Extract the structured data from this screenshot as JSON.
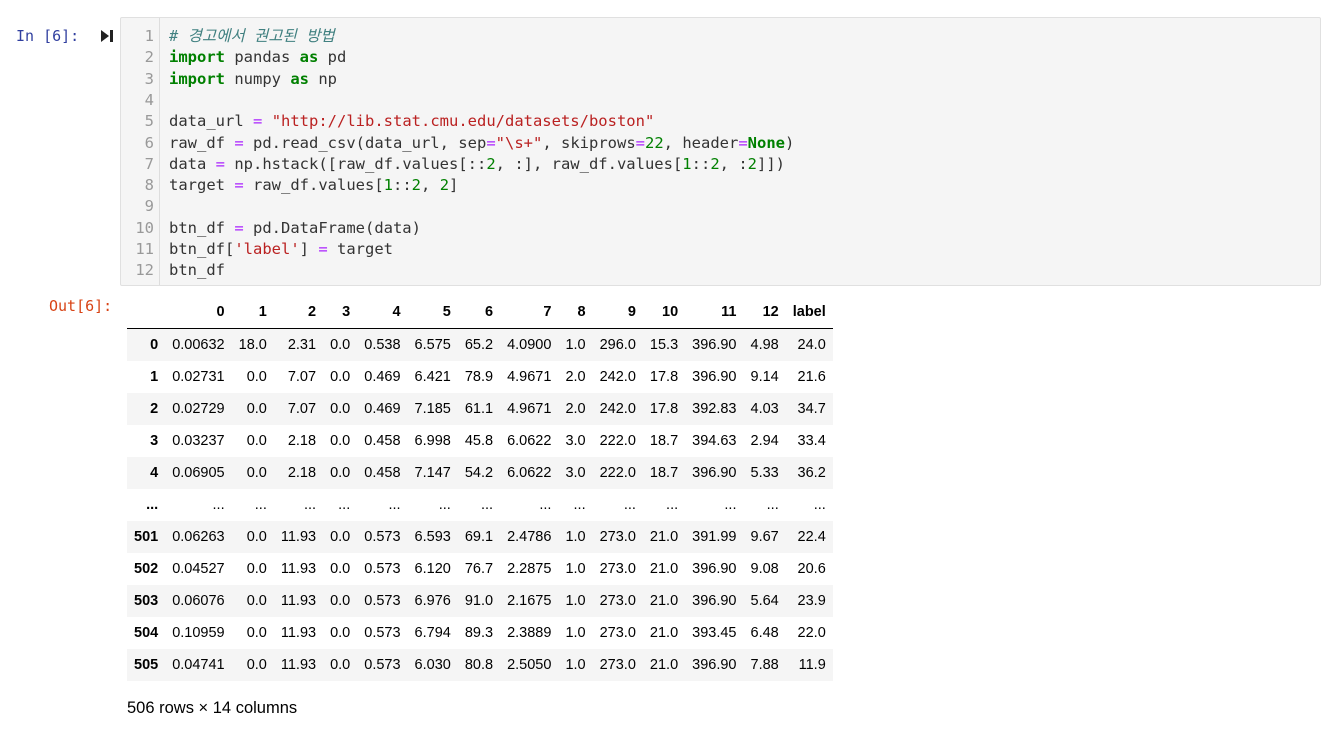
{
  "input_prompt": "In [6]:",
  "output_prompt": "Out[6]:",
  "code_lines": [
    {
      "n": "1",
      "tokens": [
        {
          "t": "# 경고에서 권고된 방법",
          "c": "c"
        }
      ]
    },
    {
      "n": "2",
      "tokens": [
        {
          "t": "import",
          "c": "kc"
        },
        {
          "t": " pandas ",
          "c": ""
        },
        {
          "t": "as",
          "c": "kc"
        },
        {
          "t": " pd",
          "c": ""
        }
      ]
    },
    {
      "n": "3",
      "tokens": [
        {
          "t": "import",
          "c": "kc"
        },
        {
          "t": " numpy ",
          "c": ""
        },
        {
          "t": "as",
          "c": "kc"
        },
        {
          "t": " np",
          "c": ""
        }
      ]
    },
    {
      "n": "4",
      "tokens": []
    },
    {
      "n": "5",
      "tokens": [
        {
          "t": "data_url ",
          "c": ""
        },
        {
          "t": "=",
          "c": "o"
        },
        {
          "t": " ",
          "c": ""
        },
        {
          "t": "\"http://lib.stat.cmu.edu/datasets/boston\"",
          "c": "s"
        }
      ]
    },
    {
      "n": "6",
      "tokens": [
        {
          "t": "raw_df ",
          "c": ""
        },
        {
          "t": "=",
          "c": "o"
        },
        {
          "t": " pd.read_csv(data_url, sep",
          "c": ""
        },
        {
          "t": "=",
          "c": "o"
        },
        {
          "t": "\"\\s+\"",
          "c": "s"
        },
        {
          "t": ", skiprows",
          "c": ""
        },
        {
          "t": "=",
          "c": "o"
        },
        {
          "t": "22",
          "c": "n"
        },
        {
          "t": ", header",
          "c": ""
        },
        {
          "t": "=",
          "c": "o"
        },
        {
          "t": "None",
          "c": "kc"
        },
        {
          "t": ")",
          "c": ""
        }
      ]
    },
    {
      "n": "7",
      "tokens": [
        {
          "t": "data ",
          "c": ""
        },
        {
          "t": "=",
          "c": "o"
        },
        {
          "t": " np.hstack([raw_df.values[::",
          "c": ""
        },
        {
          "t": "2",
          "c": "n"
        },
        {
          "t": ", :], raw_df.values[",
          "c": ""
        },
        {
          "t": "1",
          "c": "n"
        },
        {
          "t": "::",
          "c": ""
        },
        {
          "t": "2",
          "c": "n"
        },
        {
          "t": ", :",
          "c": ""
        },
        {
          "t": "2",
          "c": "n"
        },
        {
          "t": "]])",
          "c": ""
        }
      ]
    },
    {
      "n": "8",
      "tokens": [
        {
          "t": "target ",
          "c": ""
        },
        {
          "t": "=",
          "c": "o"
        },
        {
          "t": " raw_df.values[",
          "c": ""
        },
        {
          "t": "1",
          "c": "n"
        },
        {
          "t": "::",
          "c": ""
        },
        {
          "t": "2",
          "c": "n"
        },
        {
          "t": ", ",
          "c": ""
        },
        {
          "t": "2",
          "c": "n"
        },
        {
          "t": "]",
          "c": ""
        }
      ]
    },
    {
      "n": "9",
      "tokens": []
    },
    {
      "n": "10",
      "tokens": [
        {
          "t": "btn_df ",
          "c": ""
        },
        {
          "t": "=",
          "c": "o"
        },
        {
          "t": " pd.DataFrame(data)",
          "c": ""
        }
      ]
    },
    {
      "n": "11",
      "tokens": [
        {
          "t": "btn_df[",
          "c": ""
        },
        {
          "t": "'label'",
          "c": "s"
        },
        {
          "t": "] ",
          "c": ""
        },
        {
          "t": "=",
          "c": "o"
        },
        {
          "t": " target",
          "c": ""
        }
      ]
    },
    {
      "n": "12",
      "tokens": [
        {
          "t": "btn_df",
          "c": ""
        }
      ]
    }
  ],
  "table": {
    "columns": [
      "",
      "0",
      "1",
      "2",
      "3",
      "4",
      "5",
      "6",
      "7",
      "8",
      "9",
      "10",
      "11",
      "12",
      "label"
    ],
    "rows": [
      [
        "0",
        "0.00632",
        "18.0",
        "2.31",
        "0.0",
        "0.538",
        "6.575",
        "65.2",
        "4.0900",
        "1.0",
        "296.0",
        "15.3",
        "396.90",
        "4.98",
        "24.0"
      ],
      [
        "1",
        "0.02731",
        "0.0",
        "7.07",
        "0.0",
        "0.469",
        "6.421",
        "78.9",
        "4.9671",
        "2.0",
        "242.0",
        "17.8",
        "396.90",
        "9.14",
        "21.6"
      ],
      [
        "2",
        "0.02729",
        "0.0",
        "7.07",
        "0.0",
        "0.469",
        "7.185",
        "61.1",
        "4.9671",
        "2.0",
        "242.0",
        "17.8",
        "392.83",
        "4.03",
        "34.7"
      ],
      [
        "3",
        "0.03237",
        "0.0",
        "2.18",
        "0.0",
        "0.458",
        "6.998",
        "45.8",
        "6.0622",
        "3.0",
        "222.0",
        "18.7",
        "394.63",
        "2.94",
        "33.4"
      ],
      [
        "4",
        "0.06905",
        "0.0",
        "2.18",
        "0.0",
        "0.458",
        "7.147",
        "54.2",
        "6.0622",
        "3.0",
        "222.0",
        "18.7",
        "396.90",
        "5.33",
        "36.2"
      ],
      [
        "...",
        "...",
        "...",
        "...",
        "...",
        "...",
        "...",
        "...",
        "...",
        "...",
        "...",
        "...",
        "...",
        "...",
        "..."
      ],
      [
        "501",
        "0.06263",
        "0.0",
        "11.93",
        "0.0",
        "0.573",
        "6.593",
        "69.1",
        "2.4786",
        "1.0",
        "273.0",
        "21.0",
        "391.99",
        "9.67",
        "22.4"
      ],
      [
        "502",
        "0.04527",
        "0.0",
        "11.93",
        "0.0",
        "0.573",
        "6.120",
        "76.7",
        "2.2875",
        "1.0",
        "273.0",
        "21.0",
        "396.90",
        "9.08",
        "20.6"
      ],
      [
        "503",
        "0.06076",
        "0.0",
        "11.93",
        "0.0",
        "0.573",
        "6.976",
        "91.0",
        "2.1675",
        "1.0",
        "273.0",
        "21.0",
        "396.90",
        "5.64",
        "23.9"
      ],
      [
        "504",
        "0.10959",
        "0.0",
        "11.93",
        "0.0",
        "0.573",
        "6.794",
        "89.3",
        "2.3889",
        "1.0",
        "273.0",
        "21.0",
        "393.45",
        "6.48",
        "22.0"
      ],
      [
        "505",
        "0.04741",
        "0.0",
        "11.93",
        "0.0",
        "0.573",
        "6.030",
        "80.8",
        "2.5050",
        "1.0",
        "273.0",
        "21.0",
        "396.90",
        "7.88",
        "11.9"
      ]
    ]
  },
  "shape_text": "506 rows × 14 columns",
  "icons": {
    "run": "run-cell-icon"
  }
}
